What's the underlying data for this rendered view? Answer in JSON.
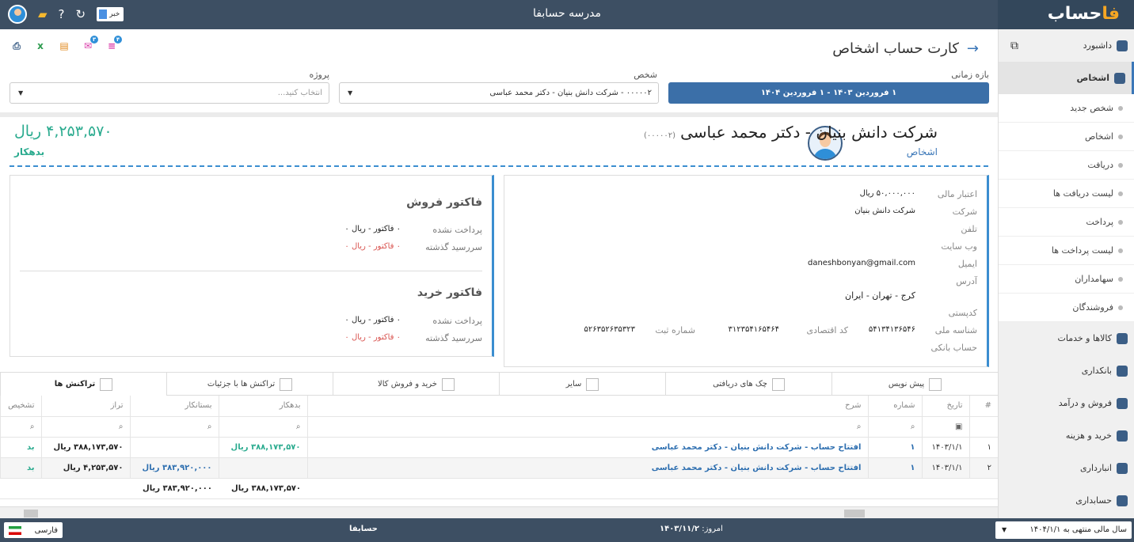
{
  "topbar": {
    "brand_prefix": "حساب",
    "brand_accent": "فا",
    "title": "مدرسه حسابفا",
    "news_label": "خبر"
  },
  "sidebar": {
    "items": [
      {
        "label": "داشبورد",
        "icon": "dashboard-icon"
      },
      {
        "label": "اشخاص",
        "icon": "people-icon",
        "active": true
      },
      {
        "label": "کالاها و خدمات",
        "icon": "box-icon"
      },
      {
        "label": "بانکداری",
        "icon": "bank-icon"
      },
      {
        "label": "فروش و درآمد",
        "icon": "sales-icon"
      },
      {
        "label": "خرید و هزینه",
        "icon": "purchase-icon"
      },
      {
        "label": "انبارداری",
        "icon": "warehouse-icon"
      },
      {
        "label": "حسابداری",
        "icon": "accounting-icon"
      }
    ],
    "subitems": [
      "شخص جدید",
      "اشخاص",
      "دریافت",
      "لیست دریافت ها",
      "پرداخت",
      "لیست پرداخت ها",
      "سهامداران",
      "فروشندگان"
    ]
  },
  "page": {
    "title": "کارت حساب اشخاص",
    "actions": [
      {
        "name": "print-icon",
        "badge": ""
      },
      {
        "name": "excel-icon",
        "badge": ""
      },
      {
        "name": "pdf-icon",
        "badge": ""
      },
      {
        "name": "sms-icon",
        "badge": "۳"
      },
      {
        "name": "message-icon",
        "badge": "۴"
      }
    ]
  },
  "filters": {
    "period_label": "بازه زمانی",
    "period_value": "۱ فروردین ۱۴۰۳ - ۱ فروردین ۱۴۰۴",
    "person_label": "شخص",
    "person_value": "۰۰۰۰۰۲ - شرکت دانش بنیان - دکتر محمد عباسی",
    "project_label": "پروژه",
    "project_placeholder": "انتخاب کنید..."
  },
  "person": {
    "name": "شرکت دانش بنیان - دکتر محمد عباسی",
    "code": "(۰۰۰۰۰۲)",
    "category": "اشخاص",
    "balance": "۴,۲۵۳,۵۷۰ ریال",
    "balance_status": "بدهکار"
  },
  "info": {
    "labels": {
      "credit": "اعتبار مالی",
      "company": "شرکت",
      "phone": "تلفن",
      "website": "وب سایت",
      "email": "ایمیل",
      "address": "آدرس",
      "postal": "کدپستی",
      "national_id": "شناسه ملی",
      "economic_code": "کد اقتصادی",
      "reg_no": "شماره ثبت",
      "bank_account": "حساب بانکی"
    },
    "credit": "۵۰,۰۰۰,۰۰۰ ریال",
    "company": "شرکت دانش بنیان",
    "email": "daneshbonyan@gmail.com",
    "address": "کرج - تهران - ایران",
    "national_id": "۵۴۱۳۴۱۳۶۵۴۶",
    "economic_code": "۳۱۲۳۵۴۱۶۵۴۶۴",
    "reg_no": "۵۲۶۳۵۲۶۳۵۳۲۳"
  },
  "invoices": {
    "sales_title": "فاکتور فروش",
    "purchase_title": "فاکتور خرید",
    "unpaid_label": "پرداخت نشده",
    "overdue_label": "سررسید گذشته",
    "sales_unpaid": "۰ فاکتور - ریال ۰",
    "sales_overdue": "۰ فاکتور - ریال ۰",
    "purchase_unpaid": "۰ فاکتور - ریال ۰",
    "purchase_overdue": "۰ فاکتور - ریال ۰"
  },
  "tabs": [
    "تراکنش ها",
    "تراکنش ها با جزئیات",
    "خرید و فروش کالا",
    "سایر",
    "چک های دریافتی",
    "پیش نویس"
  ],
  "table": {
    "headers": [
      "#",
      "تاریخ",
      "شماره",
      "شرح",
      "بدهکار",
      "بستانکار",
      "تراز",
      "تشخیص"
    ],
    "rows": [
      {
        "idx": "۱",
        "date": "۱۴۰۳/۱/۱",
        "no": "۱",
        "desc": "افتتاح حساب - شرکت دانش بنیان - دکتر محمد عباسی",
        "debit": "۳۸۸,۱۷۳,۵۷۰ ریال",
        "credit": "",
        "balance": "۳۸۸,۱۷۳,۵۷۰ ریال",
        "status": "بد"
      },
      {
        "idx": "۲",
        "date": "۱۴۰۳/۱/۱",
        "no": "۱",
        "desc": "افتتاح حساب - شرکت دانش بنیان - دکتر محمد عباسی",
        "debit": "",
        "credit": "۳۸۳,۹۲۰,۰۰۰ ریال",
        "balance": "۴,۲۵۳,۵۷۰ ریال",
        "status": "بد"
      }
    ],
    "total_debit": "۳۸۸,۱۷۳,۵۷۰ ریال",
    "total_credit": "۳۸۳,۹۲۰,۰۰۰ ریال"
  },
  "footer": {
    "language": "فارسی",
    "app": "حسابفا",
    "today_label": "امروز:",
    "today_value": "۱۴۰۳/۱۱/۲",
    "fiscal_year": "سال مالی منتهی به ۱۴۰۴/۱/۱"
  },
  "colors": {
    "topbar": "#3d4f63",
    "accent": "#3b77b8",
    "debit_green": "#2bab8f",
    "overdue_red": "#d9534f"
  }
}
